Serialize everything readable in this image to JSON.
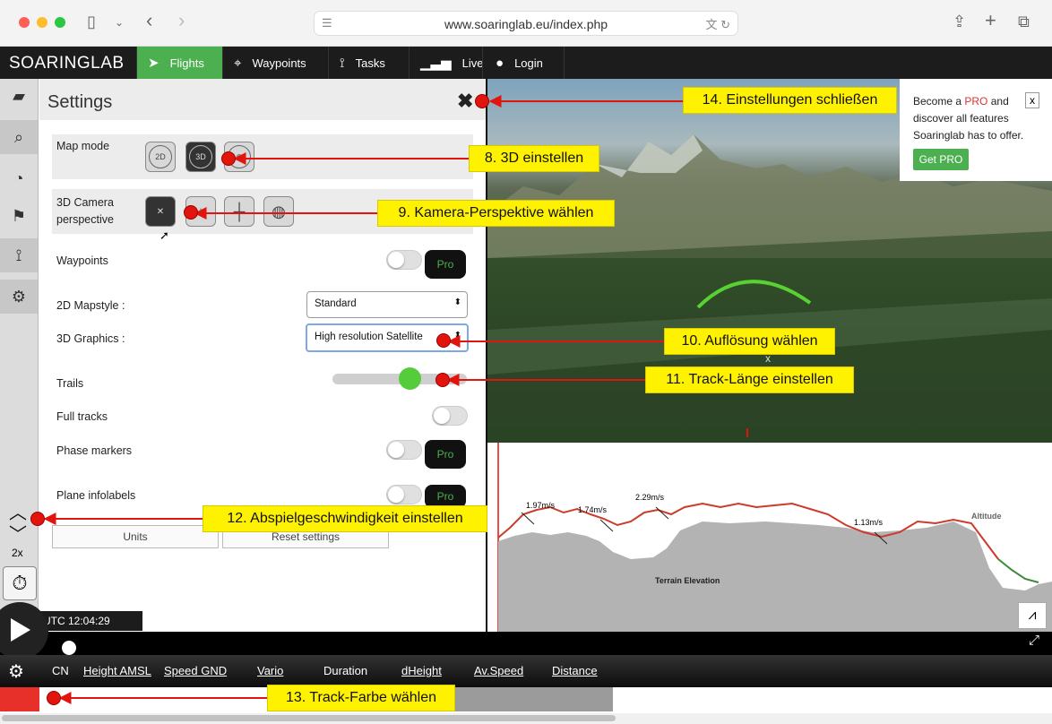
{
  "browser": {
    "url": "www.soaringlab.eu/index.php",
    "icons": {
      "sidebar": "sidebar-icon",
      "back": "back-icon",
      "forward": "forward-icon",
      "share": "share-icon",
      "new_tab": "plus-icon",
      "tabs": "tabs-icon"
    }
  },
  "app": {
    "logo": "SOARINGLAB",
    "nav": [
      {
        "label": "Flights",
        "icon": "paper-plane-icon",
        "active": true
      },
      {
        "label": "Waypoints",
        "icon": "crosshair-icon",
        "active": false
      },
      {
        "label": "Tasks",
        "icon": "tasks-icon",
        "active": false
      },
      {
        "label": "Live",
        "icon": "live-signal-icon",
        "active": false
      },
      {
        "label": "Login",
        "icon": "user-icon",
        "active": false
      }
    ]
  },
  "sidebar": {
    "items": [
      "folder-icon",
      "search-icon",
      "speedometer-icon",
      "checkered-flag-icon",
      "waypoint-route-icon",
      "gear-icon"
    ]
  },
  "settings": {
    "title": "Settings",
    "close_icon": "close-icon",
    "map_mode": {
      "label": "Map mode",
      "options": [
        "2D",
        "3D",
        "globe"
      ],
      "selected": "3D"
    },
    "camera": {
      "label": "3D Camera perspective",
      "options": [
        "follow-glider-camera-icon",
        "side-camera-icon",
        "cross-camera-icon",
        "globe-camera-icon"
      ],
      "selected": "follow-glider-camera-icon"
    },
    "waypoints": {
      "label": "Waypoints",
      "on": false,
      "pro": "Pro"
    },
    "mapstyle_2d": {
      "label": "2D Mapstyle :",
      "value": "Standard"
    },
    "graphics_3d": {
      "label": "3D Graphics :",
      "value": "High resolution Satellite"
    },
    "trails": {
      "label": "Trails",
      "level": 0.59
    },
    "full_tracks": {
      "label": "Full tracks",
      "on": false
    },
    "phase_markers": {
      "label": "Phase markers",
      "on": false,
      "pro": "Pro"
    },
    "plane_infolabels": {
      "label": "Plane infolabels",
      "on": false,
      "pro": "Pro"
    },
    "units_button": "Units",
    "reset_button": "Reset settings"
  },
  "promo": {
    "text_before": "Become a ",
    "pro_word": "PRO",
    "text_after": " and discover all features Soaringlab has to offer.",
    "button": "Get PRO",
    "close": "x"
  },
  "chart_data": {
    "type": "area",
    "title": "",
    "series": [
      {
        "name": "Altitude",
        "color": "#cc3b2b"
      },
      {
        "name": "Terrain Elevation",
        "color": "#b3b3b3"
      }
    ],
    "annotations": [
      "1.97m/s",
      "1.74m/s",
      "2.29m/s",
      "1.13m/s"
    ],
    "labels": {
      "altitude": "Altitude",
      "terrain": "Terrain Elevation"
    }
  },
  "playback": {
    "speed": "2x",
    "utc": "UTC 12:04:29",
    "position": 0.05
  },
  "data_columns": [
    {
      "label": "CN",
      "underline": false
    },
    {
      "label": "Height AMSL",
      "underline": true
    },
    {
      "label": "Speed GND",
      "underline": true
    },
    {
      "label": "Vario",
      "underline": true
    },
    {
      "label": "Duration",
      "underline": false
    },
    {
      "label": "dHeight",
      "underline": true
    },
    {
      "label": "Av.Speed",
      "underline": true
    },
    {
      "label": "Distance",
      "underline": true
    }
  ],
  "track": {
    "color": "#e8302a"
  },
  "annotations": [
    "14. Einstellungen schließen",
    "8. 3D einstellen",
    "9. Kamera-Perspektive wählen",
    "10. Auflösung wählen",
    "11. Track-Länge einstellen",
    "12. Abspielgeschwindigkeit einstellen",
    "13. Track-Farbe wählen"
  ],
  "colors": {
    "accent": "#4caf50",
    "annotation_fill": "#fff200",
    "annotation_dot": "#e2150e"
  }
}
